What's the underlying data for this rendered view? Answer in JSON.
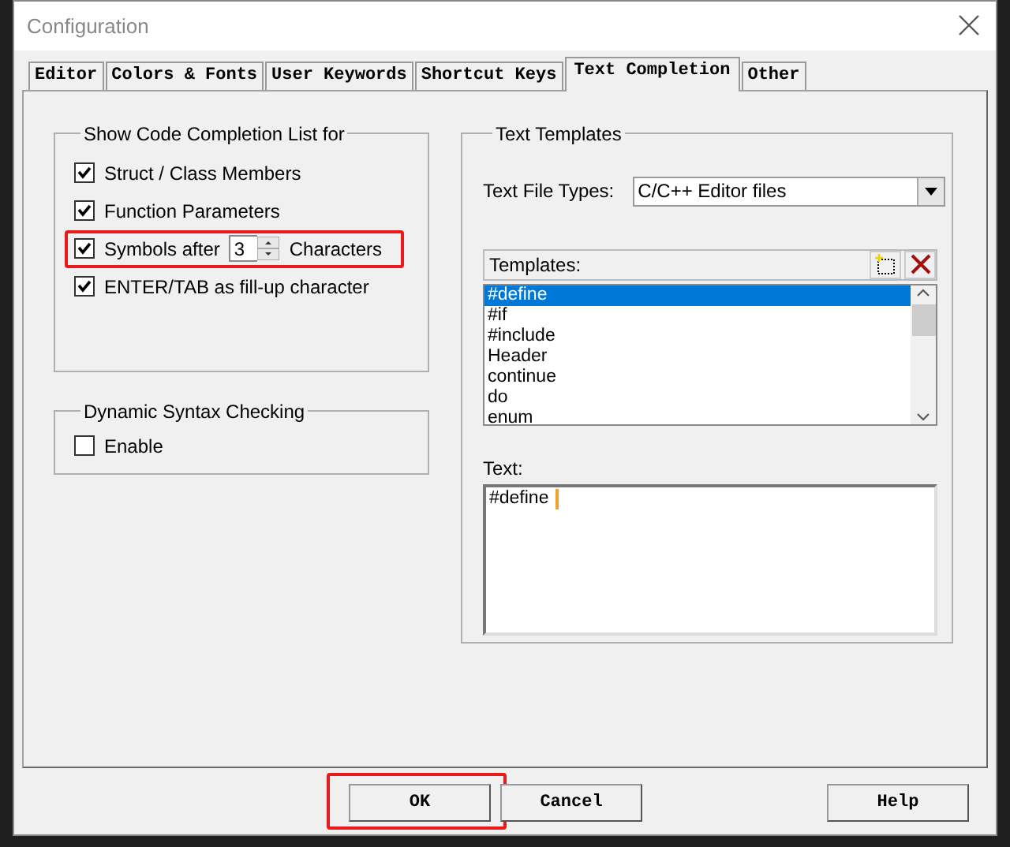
{
  "window": {
    "title": "Configuration"
  },
  "tabs": [
    {
      "label": "Editor",
      "selected": false
    },
    {
      "label": "Colors & Fonts",
      "selected": false
    },
    {
      "label": "User Keywords",
      "selected": false
    },
    {
      "label": "Shortcut Keys",
      "selected": false
    },
    {
      "label": "Text Completion",
      "selected": true
    },
    {
      "label": "Other",
      "selected": false
    }
  ],
  "completion_group": {
    "title": "Show Code Completion List for",
    "options": [
      {
        "kind": "checkbox",
        "label": "Struct / Class Members",
        "checked": true,
        "highlighted": false
      },
      {
        "kind": "checkbox",
        "label": "Function Parameters",
        "checked": true,
        "highlighted": false
      },
      {
        "kind": "spinner",
        "label": "Symbols after",
        "value": "3",
        "suffix": "Characters",
        "checked": true,
        "highlighted": true
      },
      {
        "kind": "checkbox",
        "label": "ENTER/TAB as fill-up character",
        "checked": true,
        "highlighted": false
      }
    ]
  },
  "syntax_group": {
    "title": "Dynamic Syntax Checking",
    "options": [
      {
        "kind": "checkbox",
        "label": "Enable",
        "checked": false,
        "highlighted": false
      }
    ]
  },
  "templates_group": {
    "title": "Text Templates",
    "file_types": {
      "label": "Text File Types:",
      "value": "C/C++ Editor files"
    },
    "templates": {
      "label": "Templates:",
      "items": [
        {
          "label": "#define",
          "selected": true
        },
        {
          "label": "#if",
          "selected": false
        },
        {
          "label": "#include",
          "selected": false
        },
        {
          "label": "Header",
          "selected": false
        },
        {
          "label": "continue",
          "selected": false
        },
        {
          "label": "do",
          "selected": false
        },
        {
          "label": "enum",
          "selected": false
        }
      ]
    },
    "text": {
      "label": "Text:",
      "value": "#define "
    }
  },
  "buttons": [
    {
      "kind": "left",
      "label": "OK",
      "highlighted": true
    },
    {
      "kind": "left",
      "label": "Cancel",
      "highlighted": false
    },
    {
      "kind": "right",
      "label": "Help",
      "highlighted": false
    }
  ]
}
